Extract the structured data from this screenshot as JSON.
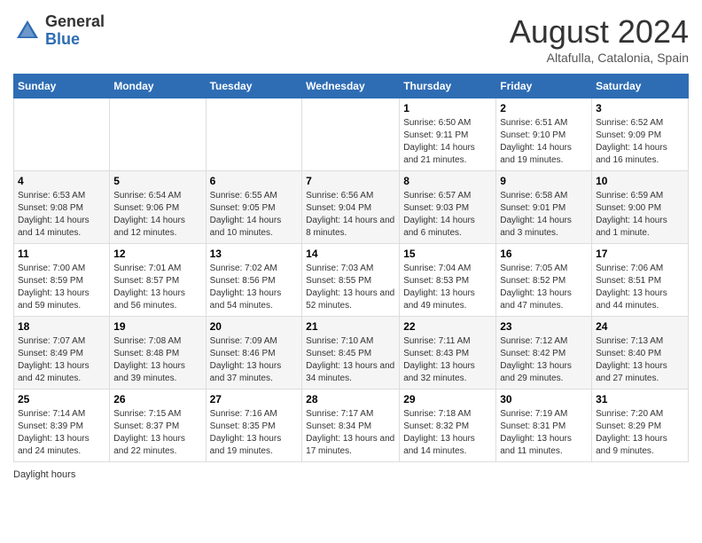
{
  "header": {
    "logo_general": "General",
    "logo_blue": "Blue",
    "month_year": "August 2024",
    "location": "Altafulla, Catalonia, Spain"
  },
  "days_of_week": [
    "Sunday",
    "Monday",
    "Tuesday",
    "Wednesday",
    "Thursday",
    "Friday",
    "Saturday"
  ],
  "weeks": [
    [
      {
        "day": "",
        "sunrise": "",
        "sunset": "",
        "daylight": ""
      },
      {
        "day": "",
        "sunrise": "",
        "sunset": "",
        "daylight": ""
      },
      {
        "day": "",
        "sunrise": "",
        "sunset": "",
        "daylight": ""
      },
      {
        "day": "",
        "sunrise": "",
        "sunset": "",
        "daylight": ""
      },
      {
        "day": "1",
        "sunrise": "6:50 AM",
        "sunset": "9:11 PM",
        "daylight": "14 hours and 21 minutes."
      },
      {
        "day": "2",
        "sunrise": "6:51 AM",
        "sunset": "9:10 PM",
        "daylight": "14 hours and 19 minutes."
      },
      {
        "day": "3",
        "sunrise": "6:52 AM",
        "sunset": "9:09 PM",
        "daylight": "14 hours and 16 minutes."
      }
    ],
    [
      {
        "day": "4",
        "sunrise": "6:53 AM",
        "sunset": "9:08 PM",
        "daylight": "14 hours and 14 minutes."
      },
      {
        "day": "5",
        "sunrise": "6:54 AM",
        "sunset": "9:06 PM",
        "daylight": "14 hours and 12 minutes."
      },
      {
        "day": "6",
        "sunrise": "6:55 AM",
        "sunset": "9:05 PM",
        "daylight": "14 hours and 10 minutes."
      },
      {
        "day": "7",
        "sunrise": "6:56 AM",
        "sunset": "9:04 PM",
        "daylight": "14 hours and 8 minutes."
      },
      {
        "day": "8",
        "sunrise": "6:57 AM",
        "sunset": "9:03 PM",
        "daylight": "14 hours and 6 minutes."
      },
      {
        "day": "9",
        "sunrise": "6:58 AM",
        "sunset": "9:01 PM",
        "daylight": "14 hours and 3 minutes."
      },
      {
        "day": "10",
        "sunrise": "6:59 AM",
        "sunset": "9:00 PM",
        "daylight": "14 hours and 1 minute."
      }
    ],
    [
      {
        "day": "11",
        "sunrise": "7:00 AM",
        "sunset": "8:59 PM",
        "daylight": "13 hours and 59 minutes."
      },
      {
        "day": "12",
        "sunrise": "7:01 AM",
        "sunset": "8:57 PM",
        "daylight": "13 hours and 56 minutes."
      },
      {
        "day": "13",
        "sunrise": "7:02 AM",
        "sunset": "8:56 PM",
        "daylight": "13 hours and 54 minutes."
      },
      {
        "day": "14",
        "sunrise": "7:03 AM",
        "sunset": "8:55 PM",
        "daylight": "13 hours and 52 minutes."
      },
      {
        "day": "15",
        "sunrise": "7:04 AM",
        "sunset": "8:53 PM",
        "daylight": "13 hours and 49 minutes."
      },
      {
        "day": "16",
        "sunrise": "7:05 AM",
        "sunset": "8:52 PM",
        "daylight": "13 hours and 47 minutes."
      },
      {
        "day": "17",
        "sunrise": "7:06 AM",
        "sunset": "8:51 PM",
        "daylight": "13 hours and 44 minutes."
      }
    ],
    [
      {
        "day": "18",
        "sunrise": "7:07 AM",
        "sunset": "8:49 PM",
        "daylight": "13 hours and 42 minutes."
      },
      {
        "day": "19",
        "sunrise": "7:08 AM",
        "sunset": "8:48 PM",
        "daylight": "13 hours and 39 minutes."
      },
      {
        "day": "20",
        "sunrise": "7:09 AM",
        "sunset": "8:46 PM",
        "daylight": "13 hours and 37 minutes."
      },
      {
        "day": "21",
        "sunrise": "7:10 AM",
        "sunset": "8:45 PM",
        "daylight": "13 hours and 34 minutes."
      },
      {
        "day": "22",
        "sunrise": "7:11 AM",
        "sunset": "8:43 PM",
        "daylight": "13 hours and 32 minutes."
      },
      {
        "day": "23",
        "sunrise": "7:12 AM",
        "sunset": "8:42 PM",
        "daylight": "13 hours and 29 minutes."
      },
      {
        "day": "24",
        "sunrise": "7:13 AM",
        "sunset": "8:40 PM",
        "daylight": "13 hours and 27 minutes."
      }
    ],
    [
      {
        "day": "25",
        "sunrise": "7:14 AM",
        "sunset": "8:39 PM",
        "daylight": "13 hours and 24 minutes."
      },
      {
        "day": "26",
        "sunrise": "7:15 AM",
        "sunset": "8:37 PM",
        "daylight": "13 hours and 22 minutes."
      },
      {
        "day": "27",
        "sunrise": "7:16 AM",
        "sunset": "8:35 PM",
        "daylight": "13 hours and 19 minutes."
      },
      {
        "day": "28",
        "sunrise": "7:17 AM",
        "sunset": "8:34 PM",
        "daylight": "13 hours and 17 minutes."
      },
      {
        "day": "29",
        "sunrise": "7:18 AM",
        "sunset": "8:32 PM",
        "daylight": "13 hours and 14 minutes."
      },
      {
        "day": "30",
        "sunrise": "7:19 AM",
        "sunset": "8:31 PM",
        "daylight": "13 hours and 11 minutes."
      },
      {
        "day": "31",
        "sunrise": "7:20 AM",
        "sunset": "8:29 PM",
        "daylight": "13 hours and 9 minutes."
      }
    ]
  ],
  "footer": {
    "daylight_note": "Daylight hours"
  }
}
